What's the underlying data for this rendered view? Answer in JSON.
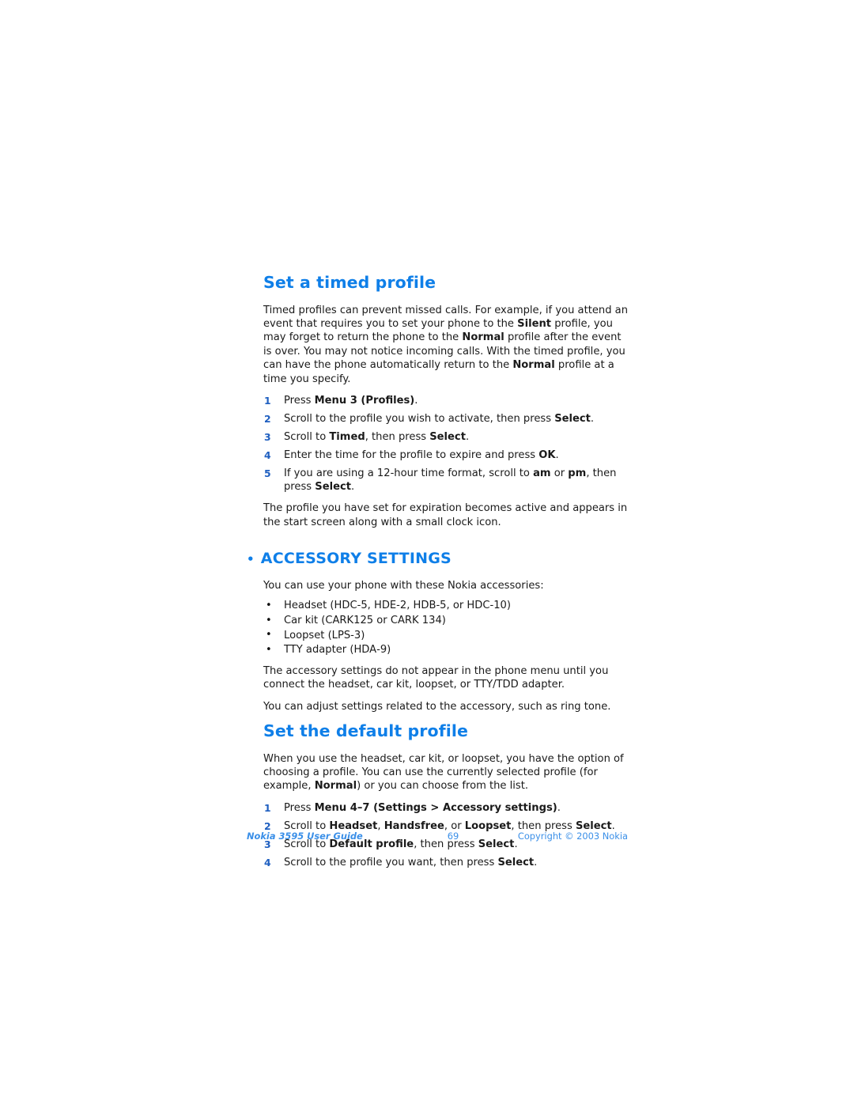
{
  "document": {
    "section1": {
      "heading": "Set a timed profile",
      "intro_parts": [
        {
          "t": "Timed profiles can prevent missed calls. For example, if you attend an event that requires you to set your phone to the ",
          "b": false
        },
        {
          "t": "Silent",
          "b": true
        },
        {
          "t": " profile, you may forget to return the phone to the ",
          "b": false
        },
        {
          "t": "Normal",
          "b": true
        },
        {
          "t": " profile after the event is over. You may not notice incoming calls. With the timed profile, you can have the phone automatically return to the ",
          "b": false
        },
        {
          "t": "Normal",
          "b": true
        },
        {
          "t": " profile at a time you specify.",
          "b": false
        }
      ],
      "steps": [
        {
          "num": "1",
          "parts": [
            {
              "t": "Press ",
              "b": false
            },
            {
              "t": "Menu 3 (Profiles)",
              "b": true
            },
            {
              "t": ".",
              "b": false
            }
          ]
        },
        {
          "num": "2",
          "parts": [
            {
              "t": "Scroll to the profile you wish to activate, then press ",
              "b": false
            },
            {
              "t": "Select",
              "b": true
            },
            {
              "t": ".",
              "b": false
            }
          ]
        },
        {
          "num": "3",
          "parts": [
            {
              "t": "Scroll to ",
              "b": false
            },
            {
              "t": "Timed",
              "b": true
            },
            {
              "t": ", then press ",
              "b": false
            },
            {
              "t": "Select",
              "b": true
            },
            {
              "t": ".",
              "b": false
            }
          ]
        },
        {
          "num": "4",
          "parts": [
            {
              "t": "Enter the time for the profile to expire and press ",
              "b": false
            },
            {
              "t": "OK",
              "b": true
            },
            {
              "t": ".",
              "b": false
            }
          ]
        },
        {
          "num": "5",
          "parts": [
            {
              "t": "If you are using a 12-hour time format, scroll to ",
              "b": false
            },
            {
              "t": "am",
              "b": true
            },
            {
              "t": " or ",
              "b": false
            },
            {
              "t": "pm",
              "b": true
            },
            {
              "t": ", then press ",
              "b": false
            },
            {
              "t": "Select",
              "b": true
            },
            {
              "t": ".",
              "b": false
            }
          ]
        }
      ],
      "closing_parts": [
        {
          "t": "The profile you have set for expiration becomes active and appears in the start screen along with a small clock icon.",
          "b": false
        }
      ]
    },
    "section2": {
      "bullet": "•",
      "heading": "ACCESSORY SETTINGS",
      "intro_parts": [
        {
          "t": "You can use your phone with these Nokia accessories:",
          "b": false
        }
      ],
      "accessories": [
        {
          "bullet": "•",
          "text": "Headset (HDC‑5, HDE‑2, HDB‑5, or HDC‑10)"
        },
        {
          "bullet": "•",
          "text": "Car kit (CARK125 or CARK 134)"
        },
        {
          "bullet": "•",
          "text": "Loopset (LPS‑3)"
        },
        {
          "bullet": "•",
          "text": "TTY adapter (HDA‑9)"
        }
      ],
      "note_parts": [
        {
          "t": "The accessory settings do not appear in the phone menu until you connect the headset, car kit, loopset, or TTY/TDD adapter.",
          "b": false
        }
      ],
      "note2_parts": [
        {
          "t": "You can adjust settings related to the accessory, such as ring tone.",
          "b": false
        }
      ]
    },
    "section3": {
      "heading": "Set the default profile",
      "intro_parts": [
        {
          "t": "When you use the headset, car kit, or loopset, you have the option of choosing a profile. You can use the currently selected profile (for example, ",
          "b": false
        },
        {
          "t": "Normal",
          "b": true
        },
        {
          "t": ") or you can choose from the list.",
          "b": false
        }
      ],
      "steps": [
        {
          "num": "1",
          "parts": [
            {
              "t": "Press ",
              "b": false
            },
            {
              "t": "Menu 4–7 (Settings > Accessory settings)",
              "b": true
            },
            {
              "t": ".",
              "b": false
            }
          ]
        },
        {
          "num": "2",
          "parts": [
            {
              "t": "Scroll to ",
              "b": false
            },
            {
              "t": "Headset",
              "b": true
            },
            {
              "t": ", ",
              "b": false
            },
            {
              "t": "Handsfree",
              "b": true
            },
            {
              "t": ", or ",
              "b": false
            },
            {
              "t": "Loopset",
              "b": true
            },
            {
              "t": ", then press ",
              "b": false
            },
            {
              "t": "Select",
              "b": true
            },
            {
              "t": ".",
              "b": false
            }
          ]
        },
        {
          "num": "3",
          "parts": [
            {
              "t": "Scroll to ",
              "b": false
            },
            {
              "t": "Default profile",
              "b": true
            },
            {
              "t": ", then press ",
              "b": false
            },
            {
              "t": "Select",
              "b": true
            },
            {
              "t": ".",
              "b": false
            }
          ]
        },
        {
          "num": "4",
          "parts": [
            {
              "t": "Scroll to the profile you want, then press ",
              "b": false
            },
            {
              "t": "Select",
              "b": true
            },
            {
              "t": ".",
              "b": false
            }
          ]
        }
      ]
    }
  },
  "footer": {
    "left": "Nokia 3595 User Guide",
    "page_number": "69",
    "right": "Copyright © 2003 Nokia"
  },
  "colors": {
    "heading_blue": "#0f7fe8",
    "step_number_blue": "#1f5fc0",
    "footer_blue": "#3a8fe8",
    "body_text": "#1a1a1a",
    "page_background": "#ffffff"
  }
}
